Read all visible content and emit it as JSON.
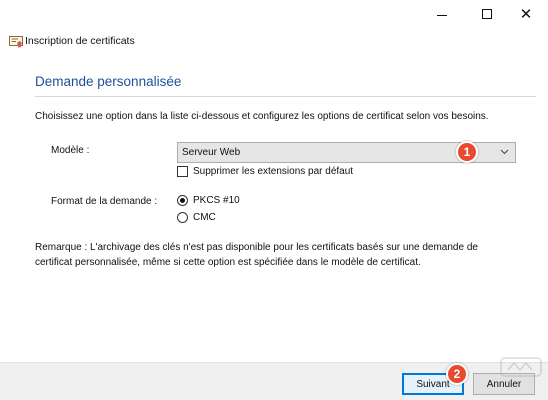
{
  "window": {
    "title": "Inscription de certificats",
    "controls": {
      "minimize_icon": "minimize-icon",
      "maximize_icon": "maximize-icon",
      "close_icon": "close-icon",
      "close_glyph": "✕"
    }
  },
  "page": {
    "heading": "Demande personnalisée",
    "instruction": "Choisissez une option dans la liste ci-dessous et configurez les options de certificat selon vos besoins."
  },
  "form": {
    "model_label": "Modèle :",
    "model_selected": "Serveur Web",
    "suppress_extensions_label": "Supprimer les extensions par défaut",
    "suppress_extensions_checked": false,
    "format_label": "Format de la demande :",
    "format_options": [
      {
        "label": "PKCS #10",
        "selected": true
      },
      {
        "label": "CMC",
        "selected": false
      }
    ]
  },
  "note": "Remarque : L'archivage des clés n'est pas disponible pour les certificats basés sur une demande de certificat personnalisée, même si cette option est spécifiée dans le modèle de certificat.",
  "footer": {
    "next_label": "Suivant",
    "cancel_label": "Annuler"
  },
  "annotations": {
    "badge_1": "1",
    "badge_2": "2",
    "badge_color": "#e84a2f"
  },
  "colors": {
    "heading": "#1f4f9a",
    "primary_button_border": "#0078d7",
    "footer_background": "#f0f0f0"
  }
}
